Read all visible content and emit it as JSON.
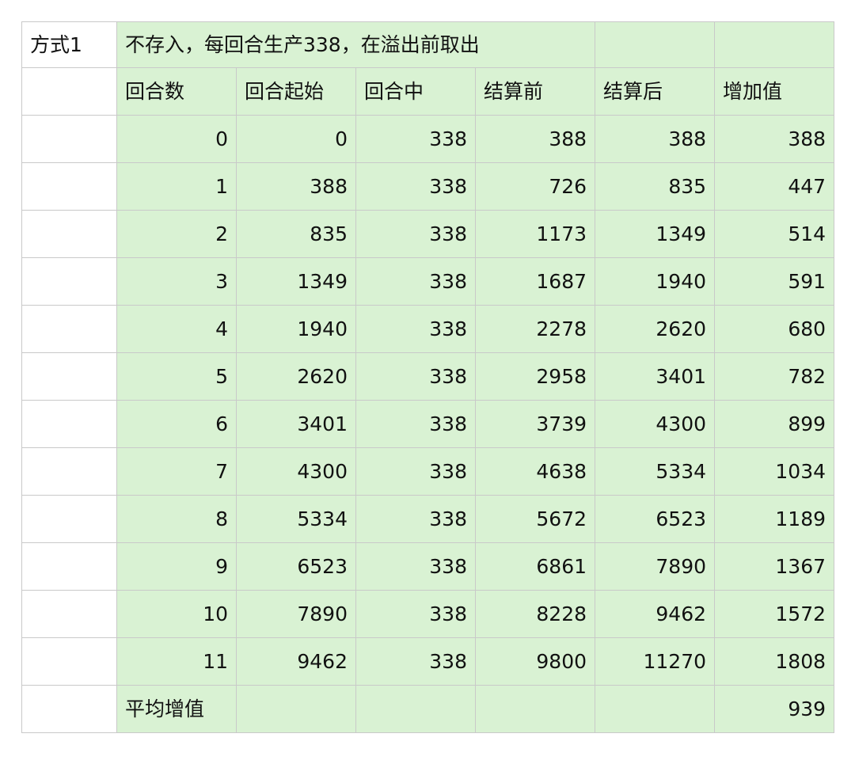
{
  "sheet": {
    "method_label": "方式1",
    "title": "不存入，每回合生产338，在溢出前取出",
    "headers": [
      "回合数",
      "回合起始",
      "回合中",
      "结算前",
      "结算后",
      "增加值"
    ],
    "rows": [
      [
        "0",
        "0",
        "338",
        "388",
        "388",
        "388"
      ],
      [
        "1",
        "388",
        "338",
        "726",
        "835",
        "447"
      ],
      [
        "2",
        "835",
        "338",
        "1173",
        "1349",
        "514"
      ],
      [
        "3",
        "1349",
        "338",
        "1687",
        "1940",
        "591"
      ],
      [
        "4",
        "1940",
        "338",
        "2278",
        "2620",
        "680"
      ],
      [
        "5",
        "2620",
        "338",
        "2958",
        "3401",
        "782"
      ],
      [
        "6",
        "3401",
        "338",
        "3739",
        "4300",
        "899"
      ],
      [
        "7",
        "4300",
        "338",
        "4638",
        "5334",
        "1034"
      ],
      [
        "8",
        "5334",
        "338",
        "5672",
        "6523",
        "1189"
      ],
      [
        "9",
        "6523",
        "338",
        "6861",
        "7890",
        "1367"
      ],
      [
        "10",
        "7890",
        "338",
        "8228",
        "9462",
        "1572"
      ],
      [
        "11",
        "9462",
        "338",
        "9800",
        "11270",
        "1808"
      ]
    ],
    "footer_label": "平均增值",
    "footer_value": "939",
    "colors": {
      "fill": "#d9f2d3",
      "grid": "#c9c9c9"
    }
  }
}
